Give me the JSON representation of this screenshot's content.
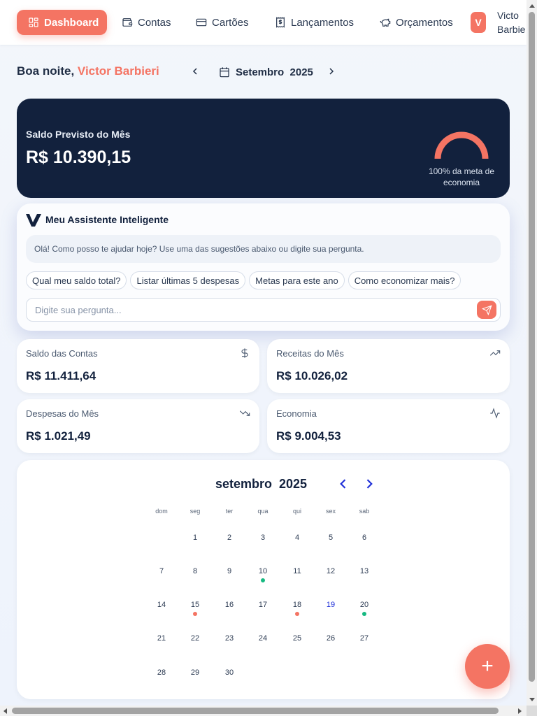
{
  "nav": {
    "items": [
      {
        "label": "Dashboard",
        "icon": "grid-icon",
        "active": true
      },
      {
        "label": "Contas",
        "icon": "wallet-icon"
      },
      {
        "label": "Cartões",
        "icon": "credit-card-icon"
      },
      {
        "label": "Lançamentos",
        "icon": "receipt-icon"
      },
      {
        "label": "Orçamentos",
        "icon": "piggy-bank-icon"
      }
    ],
    "avatar_initial": "V",
    "user_name_line1": "Victo",
    "user_name_line2": "Barbie"
  },
  "greeting": {
    "prefix": "Boa noite,",
    "name": "Victor Barbieri"
  },
  "month_selector": {
    "label": "Setembro  2025"
  },
  "balance": {
    "label": "Saldo Previsto do Mês",
    "value": "R$ 10.390,15",
    "goal_text": "100% da meta de economia",
    "goal_percent": 100
  },
  "assistant": {
    "title": "Meu Assistente Inteligente",
    "message": "Olá! Como posso te ajudar hoje? Use uma das sugestões abaixo ou digite sua pergunta.",
    "suggestions": [
      "Qual meu saldo total?",
      "Listar últimas 5 despesas",
      "Metas para este ano",
      "Como economizar mais?"
    ],
    "input_placeholder": "Digite sua pergunta..."
  },
  "stats": [
    {
      "label": "Saldo das Contas",
      "value": "R$ 11.411,64",
      "icon": "dollar-icon"
    },
    {
      "label": "Receitas do Mês",
      "value": "R$ 10.026,02",
      "icon": "trending-up-icon"
    },
    {
      "label": "Despesas do Mês",
      "value": "R$ 1.021,49",
      "icon": "trending-down-icon"
    },
    {
      "label": "Economia",
      "value": "R$ 9.004,53",
      "icon": "activity-icon"
    }
  ],
  "calendar": {
    "title": "setembro  2025",
    "weekdays": [
      "dom",
      "seg",
      "ter",
      "qua",
      "qui",
      "sex",
      "sab"
    ],
    "first_weekday": 1,
    "days_in_month": 30,
    "today": 19,
    "events": {
      "10": "income",
      "15": "expense",
      "18": "expense",
      "20": "income"
    }
  },
  "colors": {
    "accent": "#f47463",
    "navy": "#12213d",
    "income": "#16b981",
    "expense": "#f47463",
    "today": "#2030d8"
  },
  "fab_label": "+"
}
